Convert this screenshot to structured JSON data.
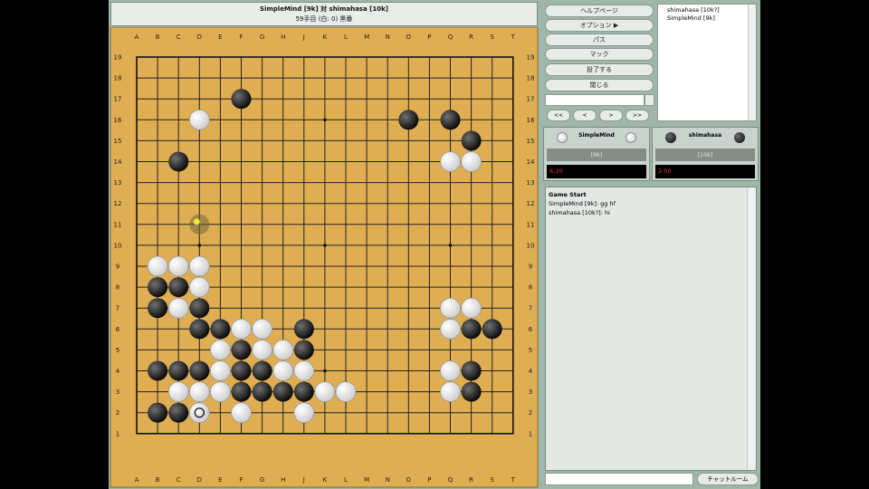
{
  "header": {
    "title": "SimpleMind [9k] 対 shimahasa [10k]",
    "subtitle": "59手目 (白: 0) 黒番"
  },
  "board": {
    "columns": [
      "A",
      "B",
      "C",
      "D",
      "E",
      "F",
      "G",
      "H",
      "J",
      "K",
      "L",
      "M",
      "N",
      "O",
      "P",
      "Q",
      "R",
      "S",
      "T"
    ],
    "rows": [
      "19",
      "18",
      "17",
      "16",
      "15",
      "14",
      "13",
      "12",
      "11",
      "10",
      "9",
      "8",
      "7",
      "6",
      "5",
      "4",
      "3",
      "2",
      "1"
    ],
    "black": [
      "F17",
      "O16",
      "Q16",
      "R15",
      "C14",
      "B8",
      "C8",
      "B7",
      "D7",
      "D6",
      "E6",
      "J6",
      "F5",
      "J5",
      "B4",
      "C4",
      "D4",
      "F4",
      "G4",
      "R4",
      "F3",
      "G3",
      "H3",
      "J3",
      "R3",
      "B2",
      "C2",
      "R6",
      "S6"
    ],
    "white": [
      "D16",
      "Q14",
      "R14",
      "B9",
      "C9",
      "D9",
      "D8",
      "C7",
      "F6",
      "G6",
      "E5",
      "G5",
      "H5",
      "E4",
      "H4",
      "J4",
      "C3",
      "D3",
      "E3",
      "K3",
      "L3",
      "F2",
      "J2",
      "Q7",
      "R7",
      "Q6",
      "Q4",
      "Q3",
      "D2"
    ],
    "last_move": "D2",
    "ko_marker": "D11"
  },
  "menu": {
    "help": "ヘルプページ",
    "options": "オプション ▶",
    "pass": "パス",
    "mark": "マック",
    "resign": "投了する",
    "close": "閉じる"
  },
  "nav": {
    "first": "<<",
    "prev": "<",
    "next": ">",
    "last": ">>"
  },
  "players_list": [
    "shimahasa [10k?]",
    "SimpleMind [9k]"
  ],
  "player_white": {
    "name": "SimpleMind",
    "rank_label": "[9k]",
    "clock": "6:20"
  },
  "player_black": {
    "name": "shimahasa",
    "rank_label": "[10k]",
    "clock": "2:50"
  },
  "chat": {
    "lines": [
      "Game Start",
      "SimpleMind [9k]: gg hf",
      "shimahasa [10k?]: hi"
    ],
    "room_button": "チャットルーム"
  }
}
